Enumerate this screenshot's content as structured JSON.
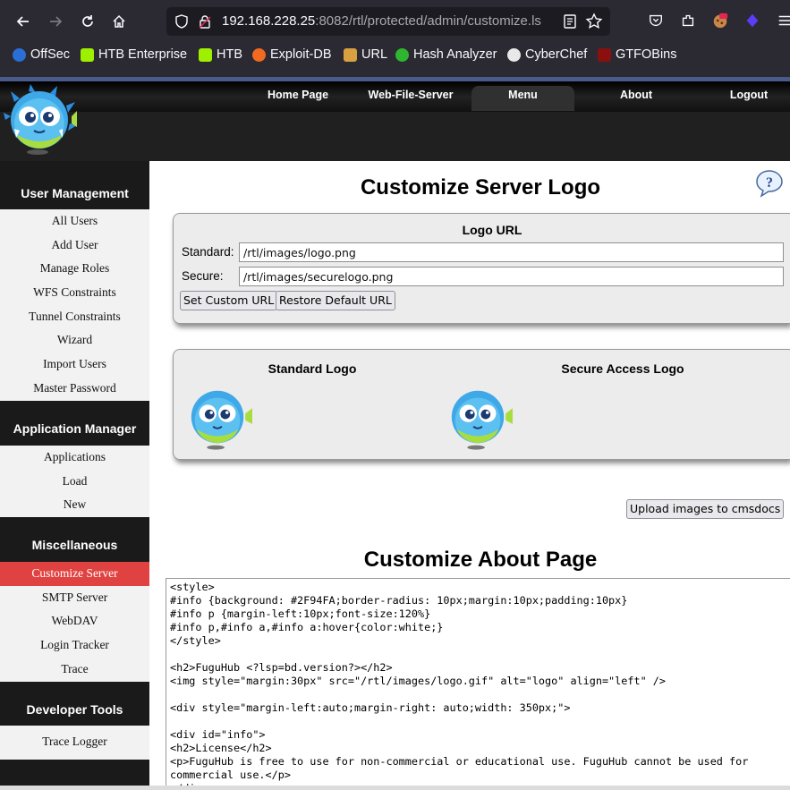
{
  "browser": {
    "url_host": "192.168.228.25",
    "url_rest": ":8082/rtl/protected/admin/customize.ls",
    "bookmarks": [
      "OffSec",
      "HTB Enterprise",
      "HTB",
      "Exploit-DB",
      "URL",
      "Hash Analyzer",
      "CyberChef",
      "GTFOBins"
    ]
  },
  "topnav": {
    "items": [
      "Home Page",
      "Web-File-Server",
      "Menu",
      "About",
      "Logout"
    ],
    "active": "Menu"
  },
  "sidebar": {
    "user_management": {
      "heading": "User Management",
      "items": [
        "All Users",
        "Add User",
        "Manage Roles",
        "WFS Constraints",
        "Tunnel Constraints",
        "Wizard",
        "Import Users",
        "Master Password"
      ]
    },
    "application_manager": {
      "heading": "Application Manager",
      "items": [
        "Applications",
        "Load",
        "New"
      ]
    },
    "miscellaneous": {
      "heading": "Miscellaneous",
      "items": [
        "Customize Server",
        "SMTP Server",
        "WebDAV",
        "Login Tracker",
        "Trace"
      ],
      "active": "Customize Server"
    },
    "developer_tools": {
      "heading": "Developer Tools",
      "items": [
        "Trace Logger"
      ]
    }
  },
  "main": {
    "logo_title": "Customize Server Logo",
    "logo_url": {
      "title": "Logo URL",
      "standard_label": "Standard:",
      "standard_value": "/rtl/images/logo.png",
      "secure_label": "Secure:",
      "secure_value": "/rtl/images/securelogo.png",
      "set_button": "Set Custom URL",
      "restore_button": "Restore Default URL"
    },
    "preview": {
      "standard_title": "Standard Logo",
      "secure_title": "Secure Access Logo"
    },
    "upload_button": "Upload images to cmsdocs",
    "about_title": "Customize About Page",
    "about_code": "<style>\n#info {background: #2F94FA;border-radius: 10px;margin:10px;padding:10px}\n#info p {margin-left:10px;font-size:120%}\n#info p,#info a,#info a:hover{color:white;}\n</style>\n\n<h2>FuguHub <?lsp=bd.version?></h2>\n<img style=\"margin:30px\" src=\"/rtl/images/logo.gif\" alt=\"logo\" align=\"left\" />\n\n<div style=\"margin-left:auto;margin-right: auto;width: 350px;\">\n\n<div id=\"info\">\n<h2>License</h2>\n<p>FuguHub is free to use for non-commercial or educational use. FuguHub cannot be used for commercial use.</p>\n</div>"
  }
}
